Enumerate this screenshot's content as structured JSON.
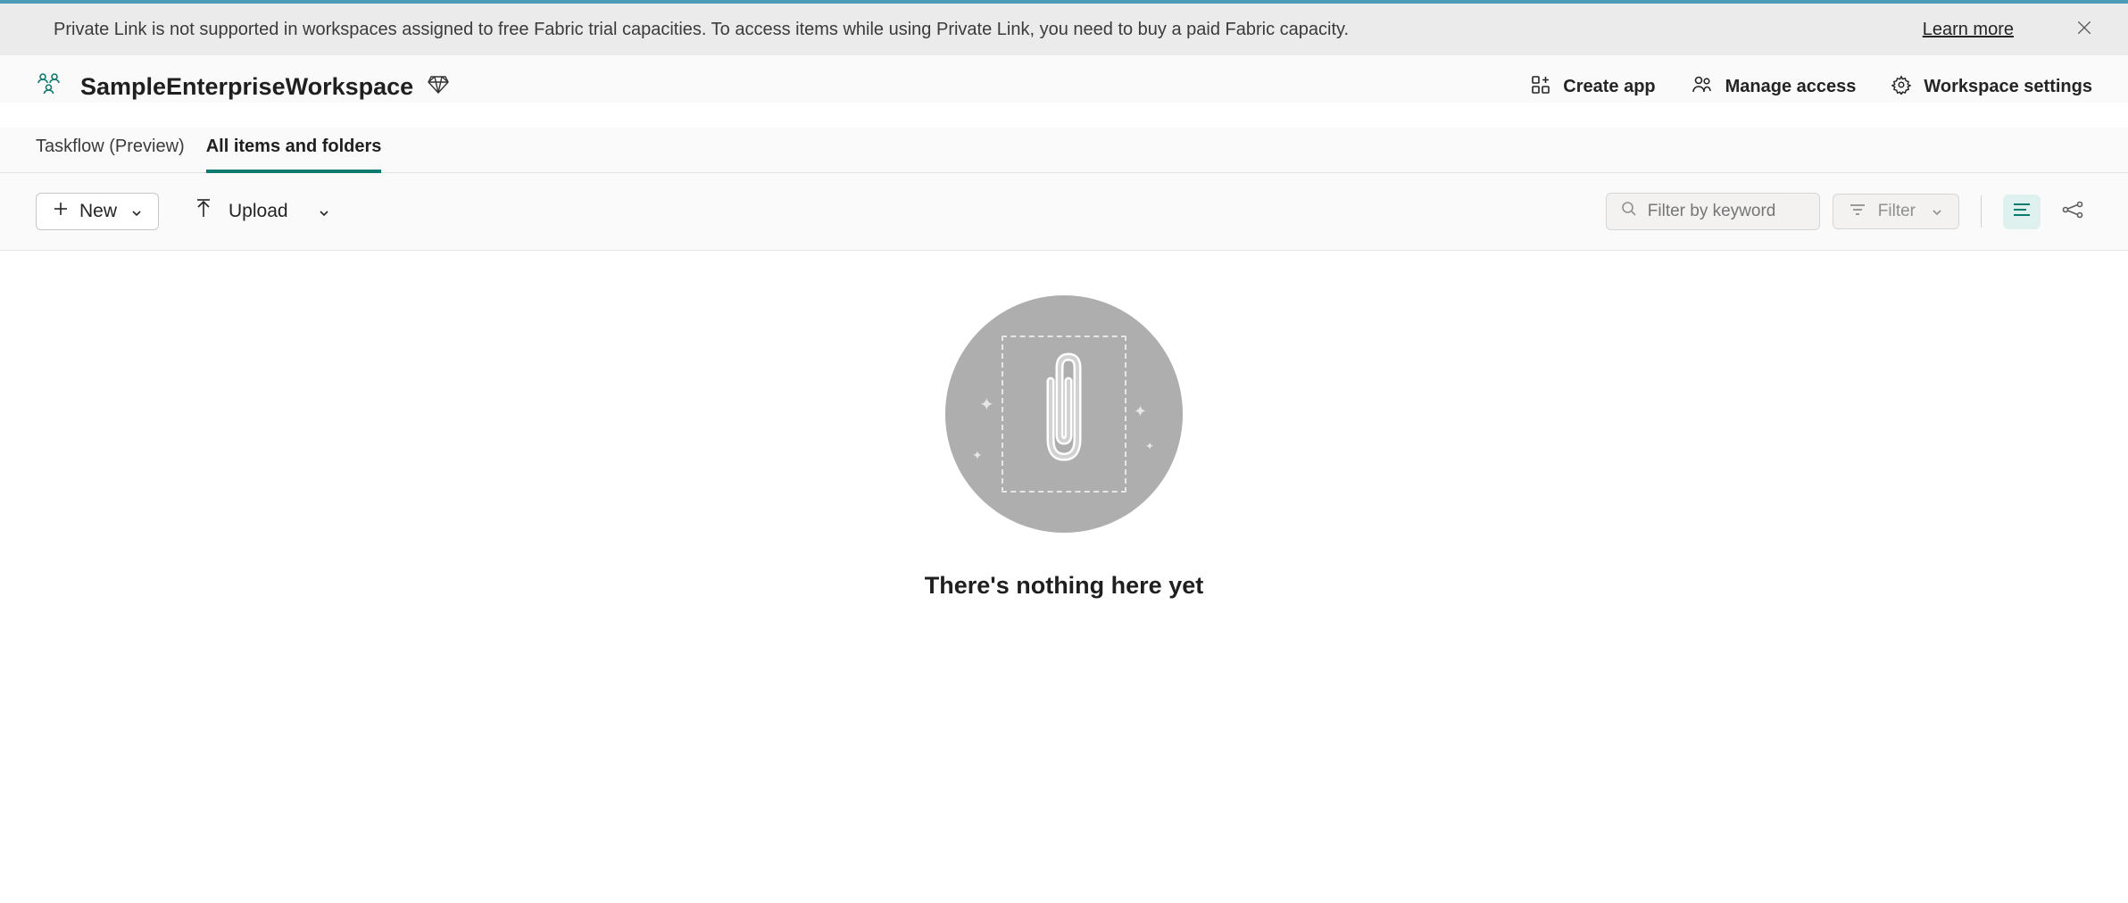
{
  "banner": {
    "text": "Private Link is not supported in workspaces assigned to free Fabric trial capacities. To access items while using Private Link, you need to buy a paid Fabric capacity.",
    "learn_more": "Learn more"
  },
  "workspace": {
    "name": "SampleEnterpriseWorkspace"
  },
  "actions": {
    "create_app": "Create app",
    "manage_access": "Manage access",
    "workspace_settings": "Workspace settings"
  },
  "tabs": {
    "taskflow": "Taskflow (Preview)",
    "all_items": "All items and folders"
  },
  "toolbar": {
    "new_label": "New",
    "upload_label": "Upload",
    "filter_placeholder": "Filter by keyword",
    "filter_button": "Filter"
  },
  "empty_state": {
    "heading": "There's nothing here yet"
  }
}
